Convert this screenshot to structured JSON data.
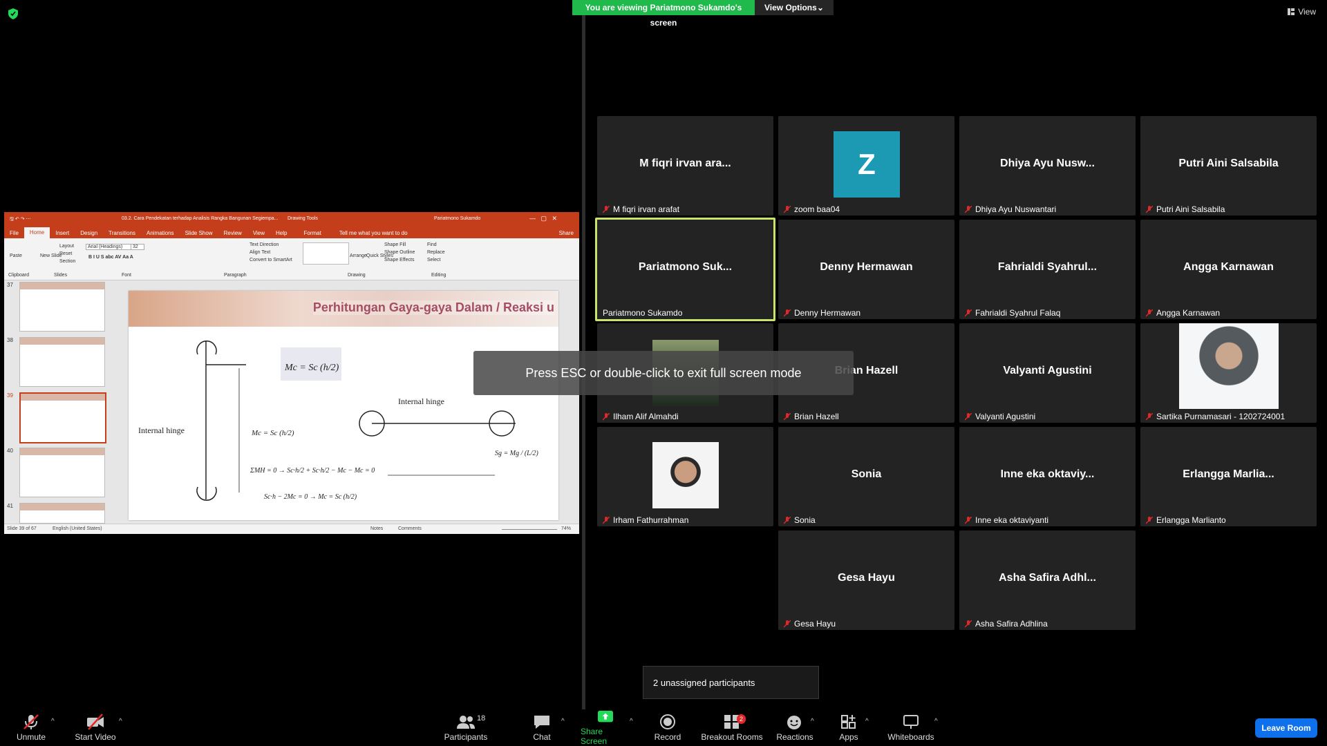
{
  "banner": {
    "viewing": "You are viewing Pariatmono Sukamdo's screen",
    "view_options": "View Options"
  },
  "view_button": "View",
  "esc_toast": "Press ESC or double-click to exit full screen mode",
  "unassigned": "2 unassigned participants",
  "ppt": {
    "title": "03.2. Cara Pendekatan terhadap Analisis Rangka Bangunan Segiempa...",
    "drawing_tools": "Drawing Tools",
    "user": "Pariatmono Sukamdo",
    "tabs": [
      "File",
      "Home",
      "Insert",
      "Design",
      "Transitions",
      "Animations",
      "Slide Show",
      "Review",
      "View",
      "Help",
      "Format"
    ],
    "tell_me": "Tell me what you want to do",
    "share": "Share",
    "groups": [
      "Clipboard",
      "Slides",
      "Font",
      "Paragraph",
      "Drawing",
      "Editing"
    ],
    "font": "Arial (Headings)",
    "font_size": "32",
    "ribbon_items": [
      "Paste",
      "New Slide",
      "Layout",
      "Reset",
      "Section",
      "Text Direction",
      "Align Text",
      "Convert to SmartArt",
      "Arrange",
      "Quick Styles",
      "Shape Fill",
      "Shape Outline",
      "Shape Effects",
      "Find",
      "Replace",
      "Select"
    ],
    "slide_numbers": [
      "37",
      "38",
      "39",
      "40",
      "41"
    ],
    "slide_title": "Perhitungan Gaya-gaya Dalam / Reaksi u",
    "diagram_labels": {
      "internal_hinge_1": "Internal hinge",
      "internal_hinge_2": "Internal hinge",
      "eq1": "Mc = Sc (h/2)",
      "eq2": "Mc = Sc (h/2)",
      "eq3": "ΣMH = 0 → Sc·h/2 + Sc·h/2 − Mc − Mc = 0",
      "eq4": "Sc·h − 2Mc = 0 → Mc = Sc (h/2)",
      "eq5": "Sg = Mg / (L/2)"
    },
    "status": {
      "slide": "Slide 39 of 67",
      "language": "English (United States)",
      "notes": "Notes",
      "comments": "Comments",
      "zoom": "74%"
    }
  },
  "participants": [
    {
      "display": "M fiqri irvan ara...",
      "label": "M fiqri irvan arafat",
      "muted": true
    },
    {
      "display": "",
      "label": "zoom baa04",
      "avatar": "Z",
      "muted": true
    },
    {
      "display": "Dhiya Ayu Nusw...",
      "label": "Dhiya Ayu Nuswantari",
      "muted": true
    },
    {
      "display": "Putri Aini Salsabila",
      "label": "Putri Aini Salsabila",
      "muted": true
    },
    {
      "display": "Pariatmono Suk...",
      "label": "Pariatmono Sukamdo",
      "muted": false,
      "active": true
    },
    {
      "display": "Denny Hermawan",
      "label": "Denny Hermawan",
      "muted": true
    },
    {
      "display": "Fahrialdi Syahrul...",
      "label": "Fahrialdi Syahrul Falaq",
      "muted": true
    },
    {
      "display": "Angga Karnawan",
      "label": "Angga Karnawan",
      "muted": true
    },
    {
      "display": "",
      "label": "Ilham Alif Almahdi",
      "muted": true
    },
    {
      "display": "Brian Hazell",
      "label": "Brian Hazell",
      "muted": true
    },
    {
      "display": "Valyanti Agustini",
      "label": "Valyanti Agustini",
      "muted": true
    },
    {
      "display": "",
      "label": "Sartika Purnamasari - 1202724001",
      "muted": true
    },
    {
      "display": "",
      "label": "Irham Fathurrahman",
      "muted": true
    },
    {
      "display": "Sonia",
      "label": "Sonia",
      "muted": true
    },
    {
      "display": "Inne eka oktaviy...",
      "label": "Inne eka oktaviyanti",
      "muted": true
    },
    {
      "display": "Erlangga Marlia...",
      "label": "Erlangga Marlianto",
      "muted": true
    },
    {
      "display": "Gesa Hayu",
      "label": "Gesa Hayu",
      "muted": true
    },
    {
      "display": "Asha Safira Adhl...",
      "label": "Asha Safira Adhlina",
      "muted": true
    }
  ],
  "toolbar": {
    "unmute": "Unmute",
    "start_video": "Start Video",
    "participants": "Participants",
    "participants_count": "18",
    "chat": "Chat",
    "share_screen": "Share Screen",
    "record": "Record",
    "breakout": "Breakout Rooms",
    "breakout_badge": "2",
    "reactions": "Reactions",
    "apps": "Apps",
    "whiteboards": "Whiteboards",
    "leave": "Leave Room"
  },
  "colors": {
    "share_green": "#1fb94c",
    "leave_blue": "#0e71eb",
    "active_border": "#c8e46a",
    "ppt_red": "#c43e1c",
    "avatar_teal": "#1c9ab3"
  }
}
